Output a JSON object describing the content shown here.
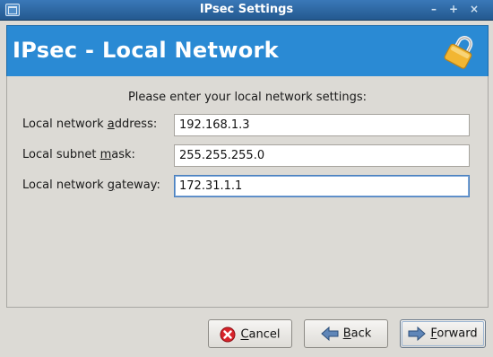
{
  "window": {
    "title": "IPsec Settings",
    "controls": {
      "minimize": "–",
      "maximize": "+",
      "close": "×"
    }
  },
  "banner": {
    "heading": "IPsec - Local Network",
    "icon": "padlock-icon"
  },
  "form": {
    "prompt": "Please enter your local network settings:",
    "address_label": {
      "pre": "Local network ",
      "mnemonic": "a",
      "post": "ddress:"
    },
    "address_value": "192.168.1.3",
    "mask_label": {
      "pre": "Local subnet ",
      "mnemonic": "m",
      "post": "ask:"
    },
    "mask_value": "255.255.255.0",
    "gateway_label": {
      "pre": "Local network ",
      "mnemonic": "g",
      "post": "ateway:"
    },
    "gateway_value": "172.31.1.1"
  },
  "buttons": {
    "cancel": {
      "mnemonic": "C",
      "rest": "ancel",
      "icon": "cancel-icon"
    },
    "back": {
      "mnemonic": "B",
      "rest": "ack",
      "icon": "back-arrow-icon"
    },
    "forward": {
      "mnemonic": "F",
      "rest": "orward",
      "icon": "forward-arrow-icon"
    }
  },
  "colors": {
    "titlebar": "#2f6aa6",
    "banner": "#2a8ad4",
    "window_bg": "#dcdad5"
  }
}
